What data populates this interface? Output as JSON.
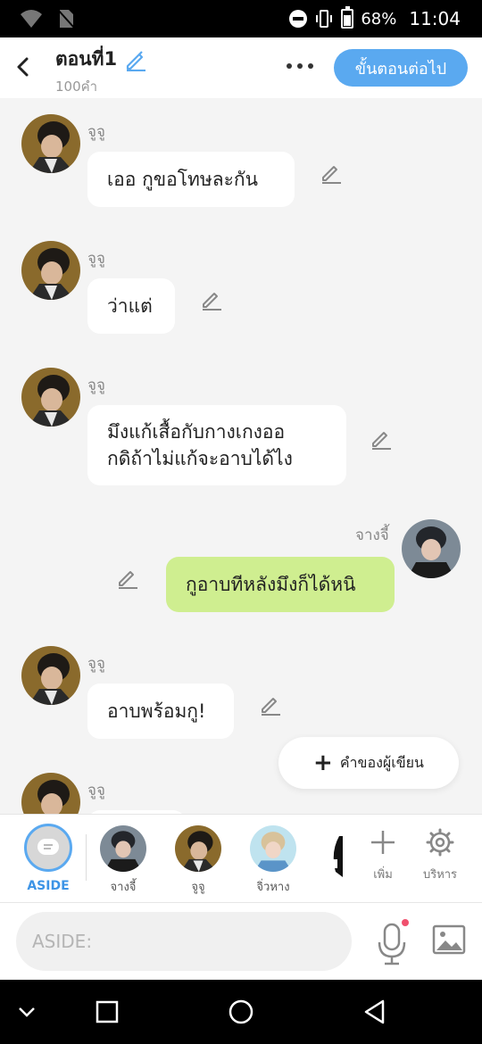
{
  "status_bar": {
    "battery": "68%",
    "time": "11:04"
  },
  "header": {
    "title": "ตอนที่1",
    "subtitle": "100คำ",
    "next_label": "ขั้นตอนต่อไป"
  },
  "messages": [
    {
      "sender": "จูจู",
      "text": "เออ กูขอโทษละกัน",
      "from_me": false
    },
    {
      "sender": "จูจู",
      "text": "ว่าแต่",
      "from_me": false
    },
    {
      "sender": "จูจู",
      "text": "มึงแก้เสื้อกับกางเกงออ\nกดิถ้าไม่แก้จะอาบได้ไง",
      "from_me": false
    },
    {
      "sender": "จางจี้",
      "text": "กูอาบทีหลังมึงก็ได้หนิ",
      "from_me": true
    },
    {
      "sender": "จูจู",
      "text": "อาบพร้อมกู!",
      "from_me": false
    },
    {
      "sender": "จูจู",
      "text": "",
      "from_me": false
    }
  ],
  "fab": {
    "label": "คำของผู้เขียน"
  },
  "character_bar": {
    "aside_label": "ASIDE",
    "characters": [
      {
        "name": "จางจี้"
      },
      {
        "name": "จูจู"
      },
      {
        "name": "จิ่วหาง"
      }
    ],
    "add_label": "เพิ่ม",
    "manage_label": "บริหาร"
  },
  "input": {
    "placeholder": "ASIDE:"
  },
  "colors": {
    "accent": "#5aa9f0",
    "my_bubble": "#cfee90",
    "other_bubble": "#ffffff",
    "background": "#f4f4f4"
  }
}
